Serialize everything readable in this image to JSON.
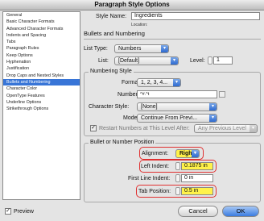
{
  "window": {
    "title": "Paragraph Style Options"
  },
  "sidebar": {
    "items": [
      {
        "label": "General",
        "selected": false
      },
      {
        "label": "Basic Character Formats",
        "selected": false
      },
      {
        "label": "Advanced Character Formats",
        "selected": false
      },
      {
        "label": "Indents and Spacing",
        "selected": false
      },
      {
        "label": "Tabs",
        "selected": false
      },
      {
        "label": "Paragraph Rules",
        "selected": false
      },
      {
        "label": "Keep Options",
        "selected": false
      },
      {
        "label": "Hyphenation",
        "selected": false
      },
      {
        "label": "Justification",
        "selected": false
      },
      {
        "label": "Drop Caps and Nested Styles",
        "selected": false
      },
      {
        "label": "Bullets and Numbering",
        "selected": true
      },
      {
        "label": "Character Color",
        "selected": false
      },
      {
        "label": "OpenType Features",
        "selected": false
      },
      {
        "label": "Underline Options",
        "selected": false
      },
      {
        "label": "Strikethrough Options",
        "selected": false
      }
    ]
  },
  "style": {
    "name_label": "Style Name:",
    "name_value": "Ingredients",
    "location_label": "Location:",
    "section_title": "Bullets and Numbering"
  },
  "list_settings": {
    "list_type_label": "List Type:",
    "list_type_value": "Numbers",
    "list_label": "List:",
    "list_value": "[Default]",
    "level_label": "Level:",
    "level_value": "1"
  },
  "numbering_style": {
    "group_label": "Numbering Style",
    "format_label": "Format:",
    "format_value": "1, 2, 3, 4...",
    "number_label": "Number:",
    "number_value": "^#.^t",
    "char_style_label": "Character Style:",
    "char_style_value": "[None]",
    "mode_label": "Mode:",
    "mode_value": "Continue From Previ...",
    "restart_label": "Restart Numbers at This Level After:",
    "restart_value": "Any Previous Level"
  },
  "position": {
    "group_label": "Bullet or Number Position",
    "alignment_label": "Alignment:",
    "alignment_value": "Right",
    "left_indent_label": "Left Indent:",
    "left_indent_value": "0.1875 in",
    "first_line_label": "First Line Indent:",
    "first_line_value": "0 in",
    "tab_position_label": "Tab Position:",
    "tab_position_value": "0.5 in"
  },
  "footer": {
    "preview_label": "Preview",
    "preview_checked": true,
    "cancel_label": "Cancel",
    "ok_label": "OK"
  },
  "colors": {
    "highlight_border": "#e03030",
    "highlight_fill": "#fff24a",
    "selection": "#3875d7"
  }
}
